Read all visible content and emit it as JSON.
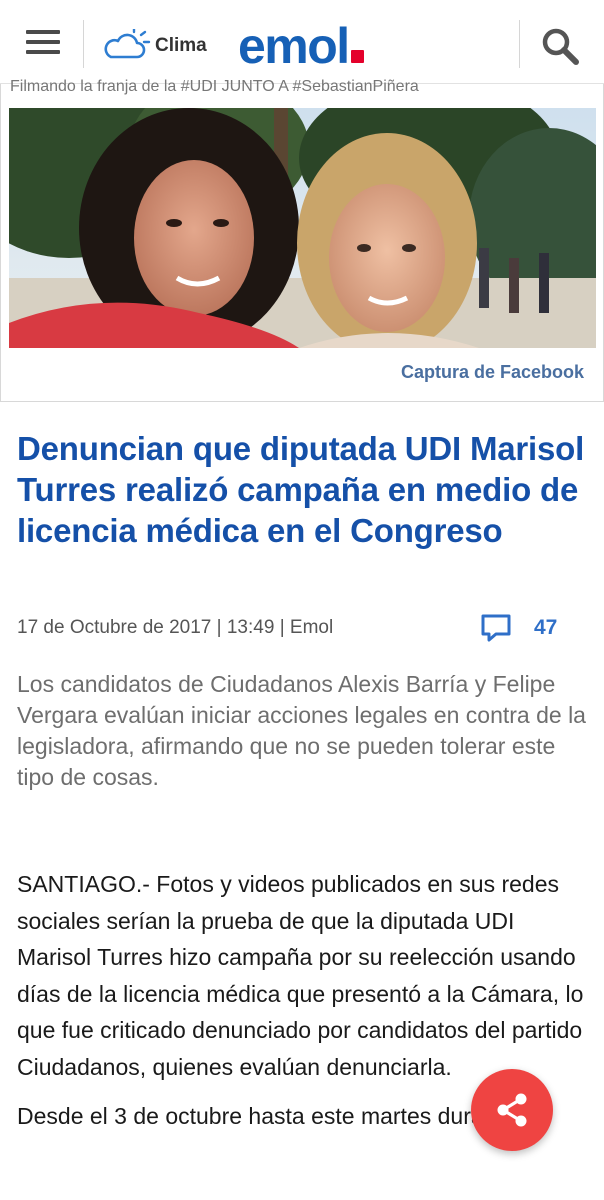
{
  "header": {
    "clima_label": "Clima",
    "logo_text": "emol",
    "logo_accent": "#e4002b",
    "brand_color": "#1660b6"
  },
  "image": {
    "strip_caption": "Filmando la franja de la #UDI JUNTO A #SebastianPiñera",
    "credit": "Captura de Facebook"
  },
  "article": {
    "headline": "Denuncian que diputada UDI Marisol Turres realizó campaña en medio de licencia médica en el Congreso",
    "meta": "17 de Octubre de 2017 | 13:49 | Emol",
    "comment_count": "47",
    "summary": "Los candidatos de Ciudadanos Alexis Barría y Felipe Vergara evalúan iniciar acciones legales en contra de la legisladora, afirmando que no se pueden tolerar este tipo de cosas.",
    "paragraphs": [
      "SANTIAGO.- Fotos y videos publicados en sus redes sociales serían la prueba de que la diputada UDI Marisol Turres hizo campaña por su reelección usando días de la licencia médica que presentó a la Cámara, lo que fue criticado denunciado por candidatos del partido Ciudadanos, quienes evalúan denunciarla.",
      "Desde el 3 de octubre hasta este martes dura"
    ]
  },
  "icons": {
    "menu": "hamburger-menu-icon",
    "weather": "cloud-sun-icon",
    "search": "magnifier-icon",
    "comments": "speech-bubble-icon",
    "share": "share-icon"
  },
  "colors": {
    "headline": "#1550a8",
    "share_button": "#ef4442",
    "comment_count": "#2f6fc8",
    "credit": "#4a6fa0"
  }
}
